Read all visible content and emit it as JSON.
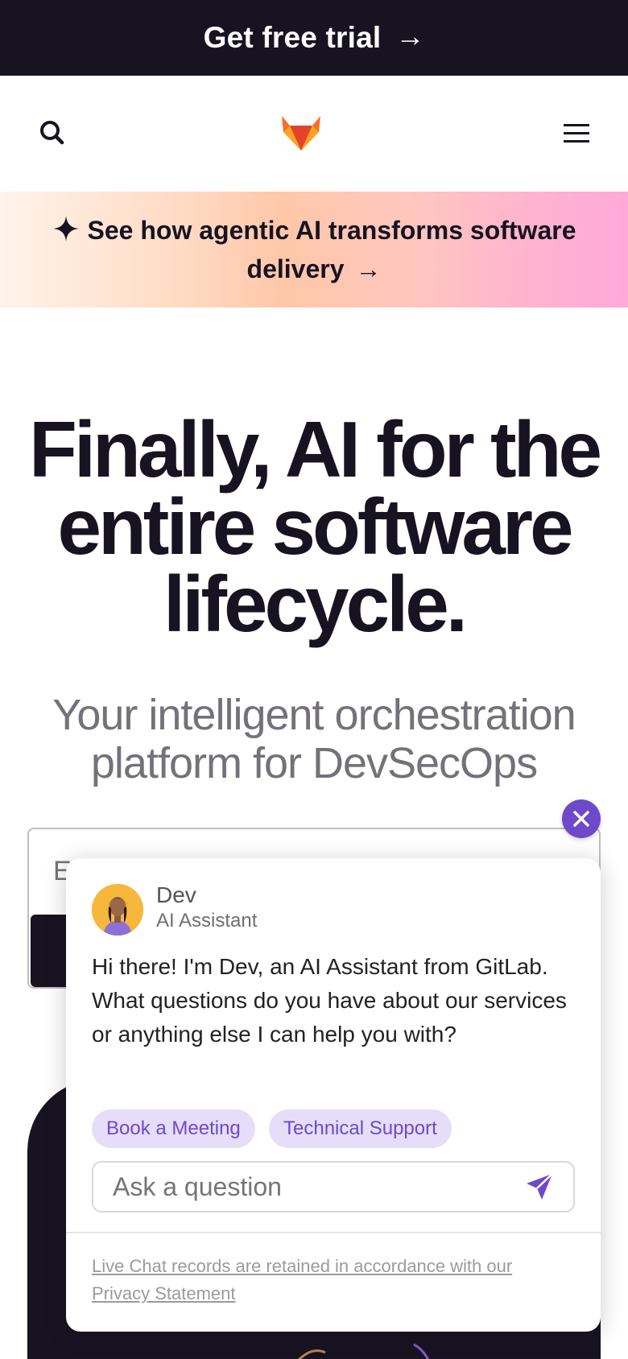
{
  "topbar": {
    "label": "Get free trial",
    "arrow": "→"
  },
  "navbar": {
    "search_icon": "search-icon",
    "logo_icon": "gitlab-tanuki-logo",
    "menu_icon": "hamburger-menu-icon"
  },
  "promo": {
    "icon": "sparkle-icon",
    "text": "See how agentic AI transforms software delivery",
    "arrow": "→"
  },
  "hero": {
    "title": "Finally, AI for the entire software lifecycle.",
    "subtitle": "Your intelligent orchestration platform for DevSecOps"
  },
  "signup": {
    "email_placeholder": "E"
  },
  "chat": {
    "close_icon": "close-icon",
    "agent_name": "Dev",
    "agent_role": "AI Assistant",
    "message": "Hi there! I'm Dev, an AI Assistant from GitLab. What questions do you have about our services or anything else I can help you with?",
    "quick_replies": [
      "Book a Meeting",
      "Technical Support"
    ],
    "input_placeholder": "Ask a question",
    "send_icon": "send-icon",
    "footer_line1": "Live Chat records are retained in accordance with our",
    "footer_link": "Privacy Statement"
  },
  "colors": {
    "dark": "#171321",
    "accent": "#6e49cb",
    "chip_bg": "#e6def8",
    "muted_text": "#74717a"
  }
}
